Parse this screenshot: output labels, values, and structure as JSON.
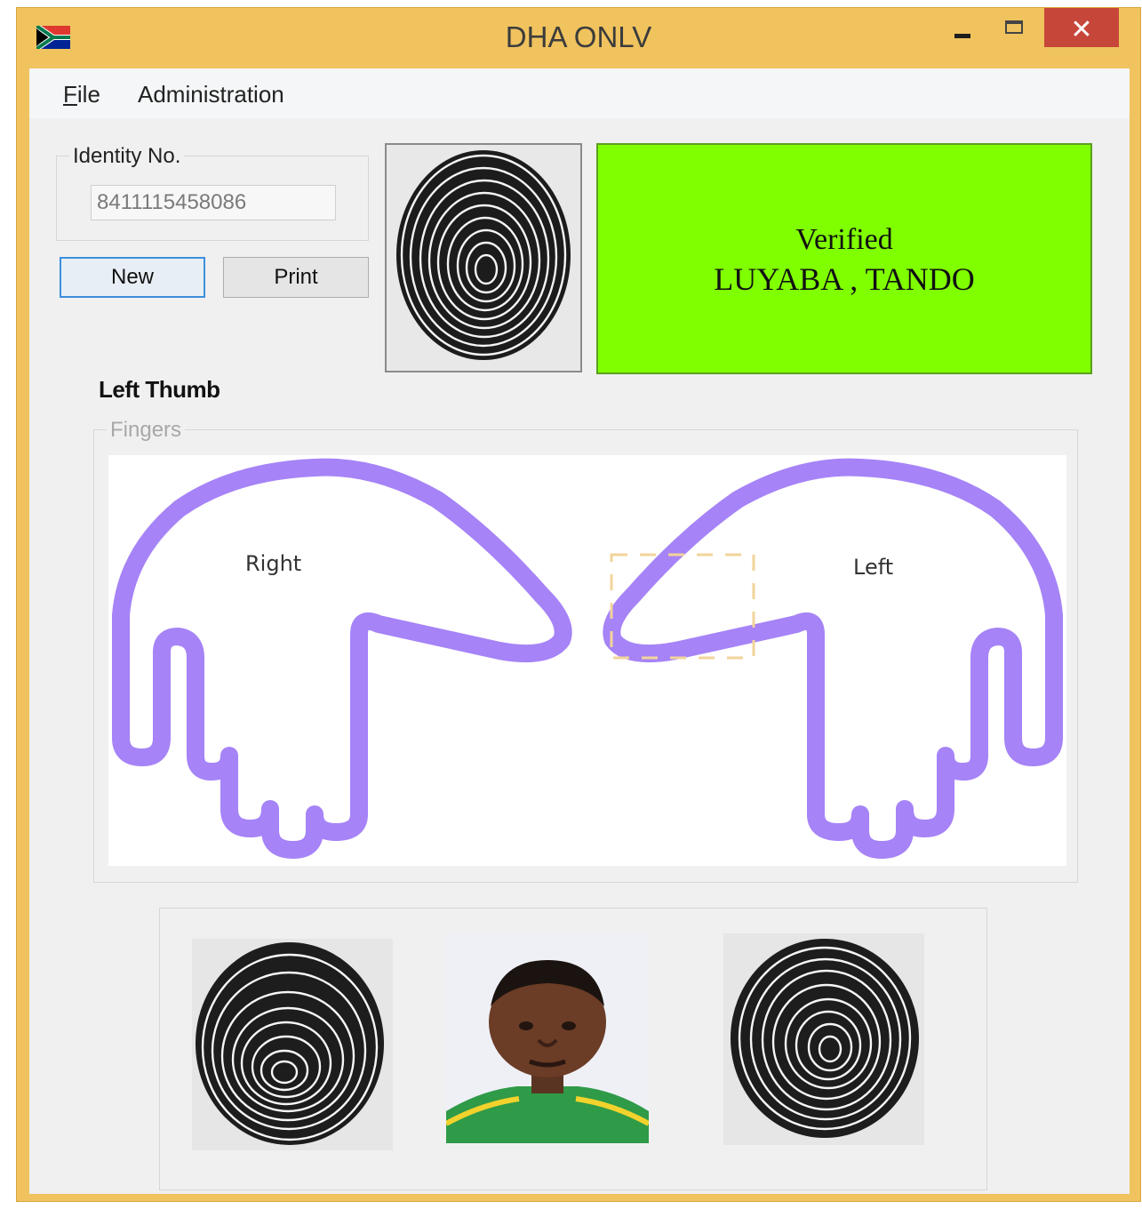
{
  "window": {
    "title": "DHA ONLV",
    "minimize_glyph": "−",
    "close_glyph": "✕"
  },
  "menu": {
    "file_mnemonic": "F",
    "file_rest": "ile",
    "administration": "Administration"
  },
  "identity": {
    "group_label": "Identity No.",
    "value": "8411115458086"
  },
  "buttons": {
    "new": "New",
    "print": "Print"
  },
  "verification": {
    "status": "Verified",
    "name": "LUYABA , TANDO",
    "panel_color": "#80ff00"
  },
  "selected_finger": "Left  Thumb",
  "fingers": {
    "group_label": "Fingers",
    "right_label": "Right",
    "left_label": "Left",
    "hand_color": "#a683f7",
    "selection_color": "#f2d49a"
  },
  "icons": {
    "app_icon": "south-africa-flag-icon",
    "fingerprint": "fingerprint-image",
    "photo": "person-photo"
  }
}
